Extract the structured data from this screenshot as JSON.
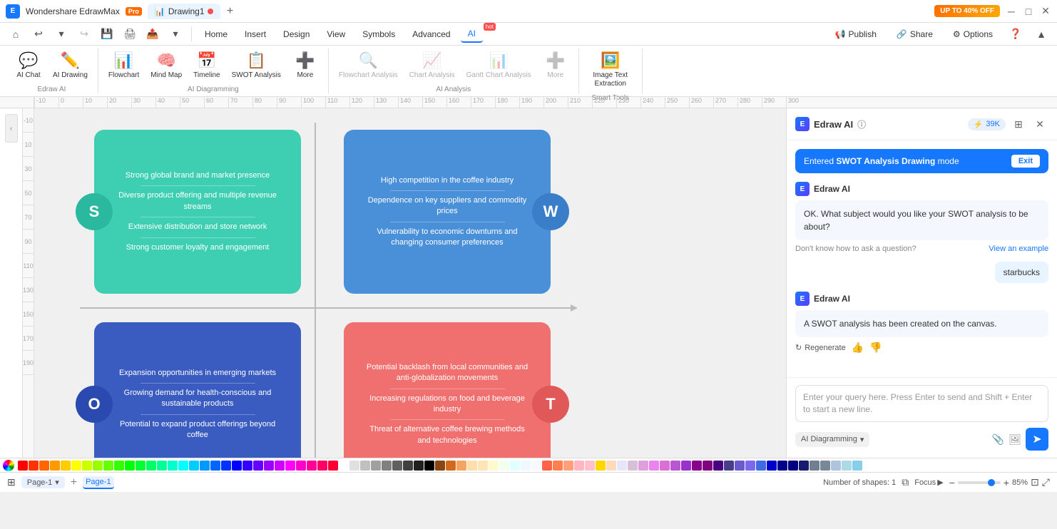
{
  "app": {
    "name": "Wondershare EdrawMax",
    "pro_badge": "Pro",
    "tab_name": "Drawing1",
    "promo": "UP TO 40% OFF"
  },
  "menu": {
    "items": [
      "Home",
      "Insert",
      "Design",
      "View",
      "Symbols",
      "Advanced",
      "AI"
    ],
    "ai_hot": "hot",
    "right_items": [
      "Publish",
      "Share",
      "Options"
    ]
  },
  "ribbon": {
    "edraw_ai_group_label": "Edraw AI",
    "ai_diagramming_group_label": "AI Diagramming",
    "ai_analysis_group_label": "AI Analysis",
    "smart_tools_group_label": "Smart Tools",
    "buttons": {
      "ai_chat": "AI Chat",
      "ai_drawing": "AI Drawing",
      "flowchart": "Flowchart",
      "mind_map": "Mind Map",
      "timeline": "Timeline",
      "swot_analysis": "SWOT Analysis",
      "more_diagramming": "More",
      "flowchart_analysis": "Flowchart Analysis",
      "chart_analysis": "Chart Analysis",
      "gantt_chart_analysis": "Gantt Chart Analysis",
      "more_analysis": "More",
      "image_text_extraction": "Image Text Extraction"
    }
  },
  "swot": {
    "s_letter": "S",
    "w_letter": "W",
    "o_letter": "O",
    "t_letter": "T",
    "s_items": [
      "Strong global brand and market presence",
      "Diverse product offering and multiple revenue streams",
      "Extensive distribution and store network",
      "Strong customer loyalty and engagement"
    ],
    "w_items": [
      "High competition in the coffee industry",
      "Dependence on key suppliers and commodity prices",
      "Vulnerability to economic downturns and changing consumer preferences"
    ],
    "o_items": [
      "Expansion opportunities in emerging markets",
      "Growing demand for health-conscious and sustainable products",
      "Potential to expand product offerings beyond coffee"
    ],
    "t_items": [
      "Potential backlash from local communities and anti-globalization movements",
      "Increasing regulations on food and beverage industry",
      "Threat of alternative coffee brewing methods and technologies"
    ]
  },
  "ai_panel": {
    "title": "Edraw AI",
    "count": "39K",
    "mode_banner": "Entered",
    "mode_name": "SWOT Analysis Drawing",
    "mode_suffix": "mode",
    "exit_label": "Exit",
    "question_message": "OK. What subject would you like your SWOT analysis to be about?",
    "hint_text": "Don't know how to ask a question?",
    "hint_link": "View an example",
    "user_message": "starbucks",
    "response_message": "A SWOT analysis has been created on the canvas.",
    "regenerate_label": "Regenerate",
    "input_placeholder": "Enter your query here. Press Enter to send and Shift + Enter to start a new line.",
    "mode_selector": "AI Diagramming",
    "send_btn": "➤"
  },
  "bottom": {
    "page_label": "Page-1",
    "active_tab": "Page-1",
    "shapes_count": "Number of shapes: 1",
    "zoom_level": "85%",
    "focus_label": "Focus"
  },
  "ruler": {
    "ticks": [
      "-10",
      "0",
      "10",
      "20",
      "30",
      "40",
      "50",
      "60",
      "70",
      "80",
      "90",
      "100",
      "110",
      "120",
      "130",
      "140",
      "150",
      "160",
      "170",
      "180",
      "190",
      "200",
      "210",
      "220",
      "230",
      "240",
      "250",
      "260",
      "270",
      "280",
      "290",
      "300"
    ]
  },
  "colors": [
    "#ff0000",
    "#ff3300",
    "#ff6600",
    "#ff9900",
    "#ffcc00",
    "#ffff00",
    "#ccff00",
    "#99ff00",
    "#66ff00",
    "#33ff00",
    "#00ff00",
    "#00ff33",
    "#00ff66",
    "#00ff99",
    "#00ffcc",
    "#00ffff",
    "#00ccff",
    "#0099ff",
    "#0066ff",
    "#0033ff",
    "#0000ff",
    "#3300ff",
    "#6600ff",
    "#9900ff",
    "#cc00ff",
    "#ff00ff",
    "#ff00cc",
    "#ff0099",
    "#ff0066",
    "#ff0033",
    "#ffffff",
    "#e0e0e0",
    "#c0c0c0",
    "#a0a0a0",
    "#808080",
    "#606060",
    "#404040",
    "#202020",
    "#000000",
    "#8B4513",
    "#D2691E",
    "#F4A460",
    "#FFDEAD",
    "#FFE4B5",
    "#FFFACD",
    "#F0FFF0",
    "#E0FFFF",
    "#F0F8FF",
    "#F8F8FF",
    "#FF6347",
    "#FF7F50",
    "#FFA07A",
    "#FFB6C1",
    "#FFC0CB",
    "#FFD700",
    "#FFDAB9",
    "#E6E6FA",
    "#D8BFD8",
    "#DDA0DD",
    "#EE82EE",
    "#DA70D6",
    "#BA55D3",
    "#9932CC",
    "#8B008B",
    "#800080",
    "#4B0082",
    "#483D8B",
    "#6A5ACD",
    "#7B68EE",
    "#4169E1",
    "#0000CD",
    "#00008B",
    "#000080",
    "#191970",
    "#708090",
    "#778899",
    "#B0C4DE",
    "#ADD8E6",
    "#87CEEB"
  ]
}
